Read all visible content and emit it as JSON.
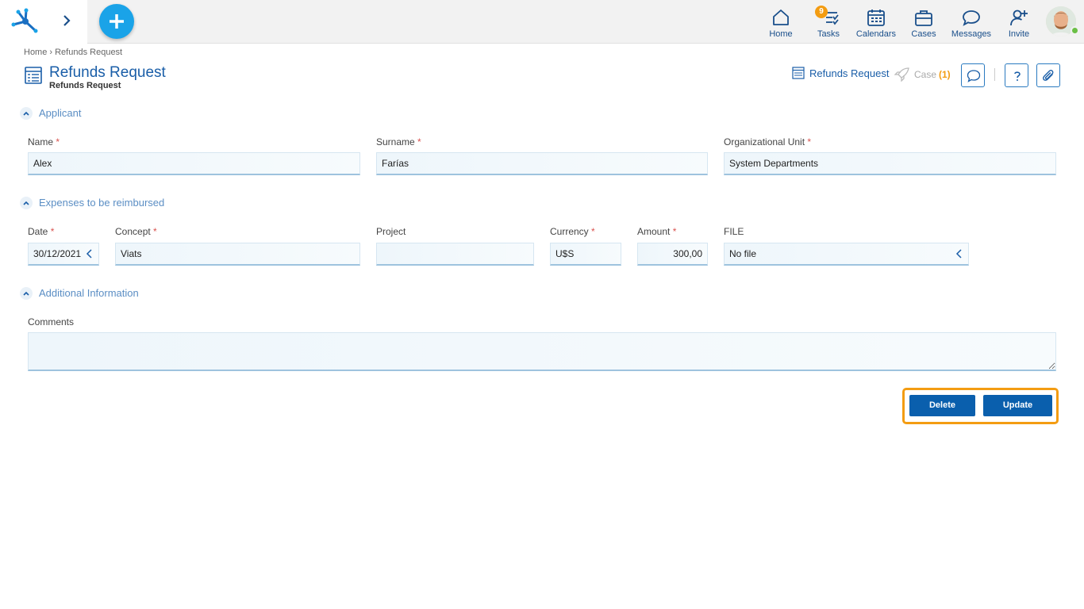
{
  "topbar": {
    "nav": [
      {
        "id": "home",
        "label": "Home",
        "icon": "home-icon"
      },
      {
        "id": "tasks",
        "label": "Tasks",
        "icon": "tasks-icon",
        "badge": "9"
      },
      {
        "id": "calendars",
        "label": "Calendars",
        "icon": "calendar-icon"
      },
      {
        "id": "cases",
        "label": "Cases",
        "icon": "briefcase-icon"
      },
      {
        "id": "messages",
        "label": "Messages",
        "icon": "chat-icon"
      },
      {
        "id": "invite",
        "label": "Invite",
        "icon": "add-user-icon"
      }
    ]
  },
  "breadcrumb": "Home › Refunds Request",
  "page": {
    "title": "Refunds Request",
    "subtitle": "Refunds Request"
  },
  "header_actions": {
    "form_label": "Refunds Request",
    "case_label": "Case",
    "case_count": "(1)"
  },
  "sections": {
    "applicant": "Applicant",
    "expenses": "Expenses to be reimbursed",
    "additional": "Additional Information"
  },
  "fields": {
    "name": {
      "label": "Name",
      "value": "Alex"
    },
    "surname": {
      "label": "Surname",
      "value": "Farías"
    },
    "org_unit": {
      "label": "Organizational Unit",
      "value": "System Departments"
    },
    "date": {
      "label": "Date",
      "value": "30/12/2021"
    },
    "concept": {
      "label": "Concept",
      "value": "Viats"
    },
    "project": {
      "label": "Project",
      "value": ""
    },
    "currency": {
      "label": "Currency",
      "value": "U$S"
    },
    "amount": {
      "label": "Amount",
      "value": "300,00"
    },
    "file": {
      "label": "FILE",
      "value": "No file"
    },
    "comments": {
      "label": "Comments",
      "value": ""
    }
  },
  "required_mark": "*",
  "buttons": {
    "delete": "Delete",
    "update": "Update"
  },
  "colors": {
    "primary": "#0a5fad",
    "accent": "#1aa3e8",
    "highlight": "#f39c12",
    "link": "#1a5ea8"
  }
}
